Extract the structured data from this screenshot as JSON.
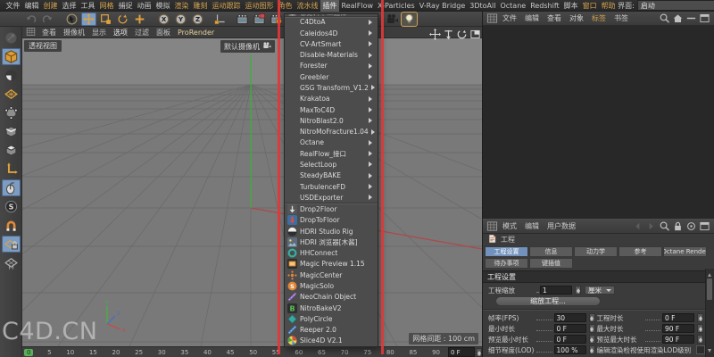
{
  "app": {
    "watermark": "C4D.CN"
  },
  "colors": {
    "accent_text": "#d2a24f",
    "tab_active": "#7292bc",
    "annotation_red": "#e13737",
    "playhead_green": "#58b058",
    "tool_active_blue": "#7d9cc2"
  },
  "titlebar": {
    "menus": [
      {
        "label": "文件"
      },
      {
        "label": "编辑"
      },
      {
        "label": "创建",
        "accent": true
      },
      {
        "label": "选择"
      },
      {
        "label": "工具"
      },
      {
        "label": "网格",
        "accent": true
      },
      {
        "label": "捕捉"
      },
      {
        "label": "动画"
      },
      {
        "label": "模拟"
      },
      {
        "label": "渲染",
        "accent": true
      },
      {
        "label": "雕刻",
        "accent": true
      },
      {
        "label": "运动跟踪",
        "accent": true
      },
      {
        "label": "运动图形",
        "accent": true
      },
      {
        "label": "角色",
        "accent": true
      },
      {
        "label": "流水线",
        "accent": true
      },
      {
        "label": "插件",
        "selected": true
      },
      {
        "label": "RealFlow"
      },
      {
        "label": "X-Particles"
      },
      {
        "label": "V-Ray Bridge"
      },
      {
        "label": "3DtoAll"
      },
      {
        "label": "Octane"
      },
      {
        "label": "Redshift"
      },
      {
        "label": "脚本"
      },
      {
        "label": "窗口",
        "accent": true
      },
      {
        "label": "帮助",
        "accent": true
      }
    ],
    "interface_label": "界面:",
    "interface_value": "启动"
  },
  "toolbar": {
    "icons": [
      {
        "name": "undo",
        "icon": "undo",
        "disabled": true
      },
      {
        "name": "redo",
        "icon": "redo",
        "disabled": true
      },
      {
        "name": "live-selection",
        "icon": "select",
        "gap": 8
      },
      {
        "name": "move-tool",
        "icon": "move",
        "active": true
      },
      {
        "name": "scale-tool",
        "icon": "scale"
      },
      {
        "name": "rotate-tool",
        "icon": "rotate"
      },
      {
        "name": "last-tool",
        "icon": "plus"
      },
      {
        "name": "lock-x-axis",
        "letter": "X",
        "gap": 8
      },
      {
        "name": "lock-y-axis",
        "letter": "Y"
      },
      {
        "name": "lock-z-axis",
        "letter": "Z"
      },
      {
        "name": "coordinate-system",
        "icon": "coords",
        "gap": 6
      },
      {
        "name": "render-view",
        "icon": "renderView",
        "gap": 6
      },
      {
        "name": "render-picture-viewer",
        "icon": "renderPV"
      },
      {
        "name": "render-settings",
        "icon": "renderSet"
      },
      {
        "name": "primitive-cube",
        "icon": "cube",
        "gap": 6
      },
      {
        "name": "camera-objects",
        "icon": "camera",
        "gap": 86
      },
      {
        "name": "light-objects",
        "icon": "light",
        "selected": true
      }
    ]
  },
  "left_toolbar": {
    "icons": [
      {
        "name": "make-editable",
        "icon": "editable",
        "disabled": true
      },
      {
        "name": "model-mode",
        "icon": "cubeOrange",
        "active": true
      },
      {
        "name": "texture-mode",
        "icon": "texture"
      },
      {
        "name": "workplane-mode",
        "icon": "workplane"
      },
      {
        "name": "point-mode",
        "icon": "points"
      },
      {
        "name": "edge-mode",
        "icon": "edges"
      },
      {
        "name": "polygon-mode",
        "icon": "polys"
      },
      {
        "name": "axis-mode",
        "icon": "axis"
      },
      {
        "name": "tweak-mode",
        "icon": "tweak",
        "active": true
      },
      {
        "name": "solo-mode",
        "icon": "solo"
      },
      {
        "name": "snap-mode",
        "icon": "magnet"
      },
      {
        "name": "workplane-lock",
        "icon": "wpLock",
        "active": true
      },
      {
        "name": "workplane-grid",
        "icon": "wpGrid"
      }
    ]
  },
  "viewport": {
    "menu": [
      {
        "label": "查看"
      },
      {
        "label": "摄像机"
      },
      {
        "label": "显示"
      },
      {
        "label": "选项",
        "bright": true
      },
      {
        "label": "过滤"
      },
      {
        "label": "面板"
      },
      {
        "label": "ProRender",
        "accent": true
      }
    ],
    "view_label": "透视视图",
    "camera_button": "默认摄像机",
    "grid_info": "网格间距 : 100 cm",
    "nav_icons": [
      {
        "name": "pan-view",
        "icon": "navPan"
      },
      {
        "name": "zoom-view",
        "icon": "navZoom"
      },
      {
        "name": "rotate-view",
        "icon": "navRotate"
      },
      {
        "name": "toggle-view",
        "icon": "navMax"
      }
    ]
  },
  "plugin_menu": {
    "history_item": {
      "label": "重执行上一插件",
      "disabled": true
    },
    "submenu_items": [
      {
        "label": "C4DtoA"
      },
      {
        "label": "Caleidos4D"
      },
      {
        "label": "CV-ArtSmart"
      },
      {
        "label": "Disable-Materials"
      },
      {
        "label": "Forester"
      },
      {
        "label": "Greebler"
      },
      {
        "label": "GSG Transform_V1.2"
      },
      {
        "label": "Krakatoa"
      },
      {
        "label": "MaxToC4D"
      },
      {
        "label": "NitroBlast2.0"
      },
      {
        "label": "NitroMoFracture1.04"
      },
      {
        "label": "Octane"
      },
      {
        "label": "RealFlow_接口"
      },
      {
        "label": "SelectLoop"
      },
      {
        "label": "SteadyBAKE"
      },
      {
        "label": "TurbulenceFD"
      },
      {
        "label": "USDExporter"
      }
    ],
    "command_items": [
      {
        "label": "Drop2Floor",
        "icon": "d2f"
      },
      {
        "label": "DropToFloor",
        "icon": "dtf"
      },
      {
        "label": "HDRI Studio Rig",
        "icon": "hdriRig"
      },
      {
        "label": "HDRI 浏览器[木酱]",
        "icon": "hdriBrowser"
      },
      {
        "label": "HHConnect",
        "icon": "hh"
      },
      {
        "label": "Magic Preview 1.15",
        "icon": "magicPrev"
      },
      {
        "label": "MagicCenter",
        "icon": "magicCenter"
      },
      {
        "label": "MagicSolo",
        "icon": "magicSolo"
      },
      {
        "label": "NeoChain Object",
        "icon": "neochain"
      },
      {
        "label": "NitroBakeV2",
        "icon": "nitrobake"
      },
      {
        "label": "PolyCircle",
        "icon": "polycircle"
      },
      {
        "label": "Reeper 2.0",
        "icon": "reeper"
      },
      {
        "label": "Slice4D V2.1",
        "icon": "slice4d"
      }
    ]
  },
  "object_manager": {
    "menu": [
      {
        "label": "文件"
      },
      {
        "label": "编辑"
      },
      {
        "label": "查看"
      },
      {
        "label": "对象"
      },
      {
        "label": "标签",
        "accent": true
      },
      {
        "label": "书签"
      }
    ],
    "icons": [
      {
        "name": "search",
        "icon": "search"
      },
      {
        "name": "home",
        "icon": "home"
      },
      {
        "name": "minimize",
        "icon": "minus"
      },
      {
        "name": "window",
        "icon": "window"
      }
    ]
  },
  "attribute_manager": {
    "menu": [
      {
        "label": "模式"
      },
      {
        "label": "编辑"
      },
      {
        "label": "用户数据"
      }
    ],
    "icons": [
      {
        "name": "nav-back",
        "icon": "navL",
        "disabled": true
      },
      {
        "name": "nav-forward",
        "icon": "navR",
        "disabled": true
      },
      {
        "name": "search",
        "icon": "search"
      },
      {
        "name": "lock",
        "icon": "lock"
      },
      {
        "name": "focus",
        "icon": "target"
      },
      {
        "name": "window",
        "icon": "window"
      }
    ],
    "object_label": "工程",
    "tabs": [
      {
        "label": "工程设置",
        "active": true
      },
      {
        "label": "信息"
      },
      {
        "label": "动力学"
      },
      {
        "label": "参考"
      },
      {
        "label": "Octane Render"
      }
    ],
    "tabs2": [
      {
        "label": "待办事项"
      },
      {
        "label": "键插值"
      }
    ],
    "section_title": "工程设置",
    "scale_row": {
      "label": "工程缩放",
      "value": "1",
      "unit": "厘米"
    },
    "scale_button": "缩放工程...",
    "rows": [
      {
        "label": "帧率(FPS)",
        "value": "30",
        "label2": "工程时长",
        "value2": "0 F"
      },
      {
        "label": "最小时长",
        "value": "0 F",
        "label2": "最大时长",
        "value2": "90 F"
      },
      {
        "label": "预览最小时长",
        "value": "0 F",
        "label2": "预览最大时长",
        "value2": "90 F"
      },
      {
        "label": "细节程度(LOD)",
        "value": "100 %",
        "label2": "编辑渲染检视使用渲染LOD级别",
        "checkbox": true
      }
    ]
  },
  "timeline": {
    "ticks": [
      "0",
      "5",
      "10",
      "15",
      "20",
      "25",
      "30",
      "35",
      "40",
      "45",
      "50",
      "55",
      "60",
      "65",
      "70",
      "75",
      "80",
      "85",
      "90"
    ],
    "frame_field": "0 F"
  }
}
